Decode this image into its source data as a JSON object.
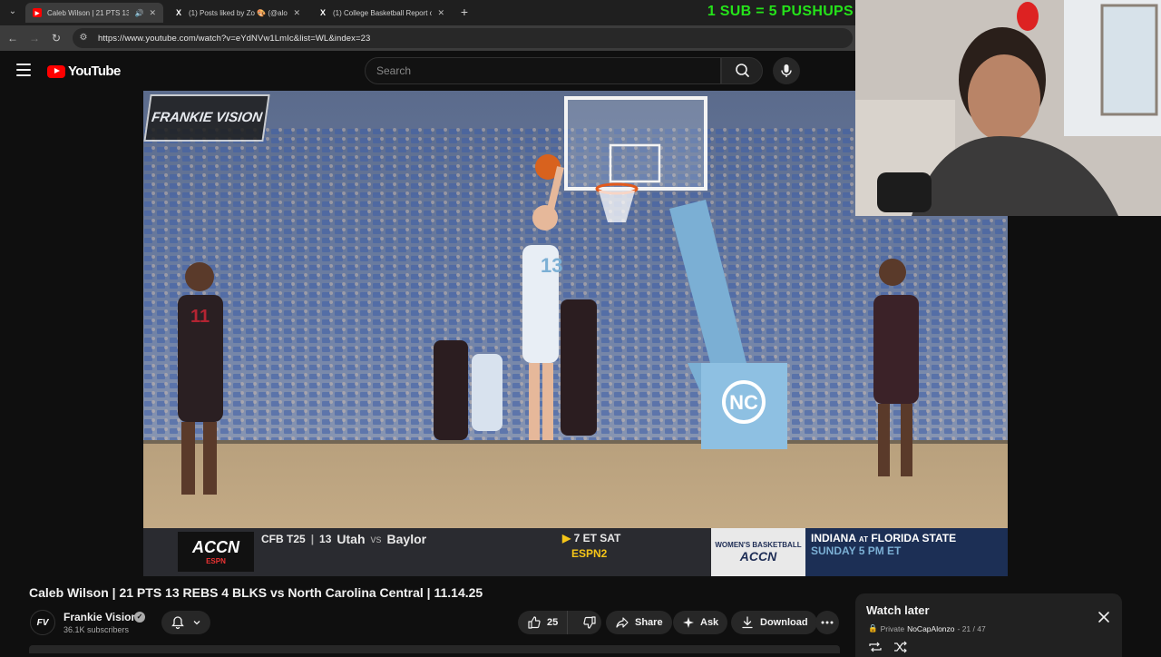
{
  "browser": {
    "tabs": [
      {
        "title": "Caleb Wilson | 21 PTS 13 RE",
        "icon": "youtube-favicon",
        "active": true
      },
      {
        "title": "(1) Posts liked by Zo 🎨 (@alon",
        "icon": "x-favicon",
        "active": false
      },
      {
        "title": "(1) College Basketball Report o",
        "icon": "x-favicon",
        "active": false
      }
    ],
    "url": "https://www.youtube.com/watch?v=eYdNVw1LmIc&list=WL&index=23"
  },
  "overlay_banner": "1 SUB = 5 PUSHUPS",
  "youtube": {
    "logo_text": "YouTube",
    "search_placeholder": "Search"
  },
  "video": {
    "watermark": "FRANKIE VISION",
    "scoreboard": {
      "network": "ACCN",
      "network_sub": "ESPN",
      "league": "CFB T25",
      "team1_rank": "13",
      "team1": "Utah",
      "vs": "vs",
      "team2": "Baylor",
      "time": "7 ET SAT",
      "channel": "ESPN2",
      "promo_top": "WOMEN'S BASKETBALL",
      "promo_net": "ACCN",
      "promo_matchup_a": "INDIANA",
      "promo_at": "AT",
      "promo_matchup_b": "FLORIDA STATE",
      "promo_time": "SUNDAY 5 PM ET"
    },
    "jersey_numbers": [
      "13",
      "11"
    ],
    "title": "Caleb Wilson | 21 PTS 13 REBS 4 BLKS vs North Carolina Central | 11.14.25"
  },
  "channel": {
    "name": "Frankie Vision",
    "avatar_text": "FV",
    "subscribers": "36.1K subscribers"
  },
  "actions": {
    "like_count": "25",
    "share": "Share",
    "ask": "Ask",
    "download": "Download"
  },
  "watch_later": {
    "title": "Watch later",
    "privacy": "Private",
    "owner": "NoCapAlonzo",
    "position": "- 21 / 47"
  },
  "colors": {
    "youtube_red": "#ff0000",
    "banner_green": "#25e21a",
    "carolina_blue": "#7bafd4"
  }
}
